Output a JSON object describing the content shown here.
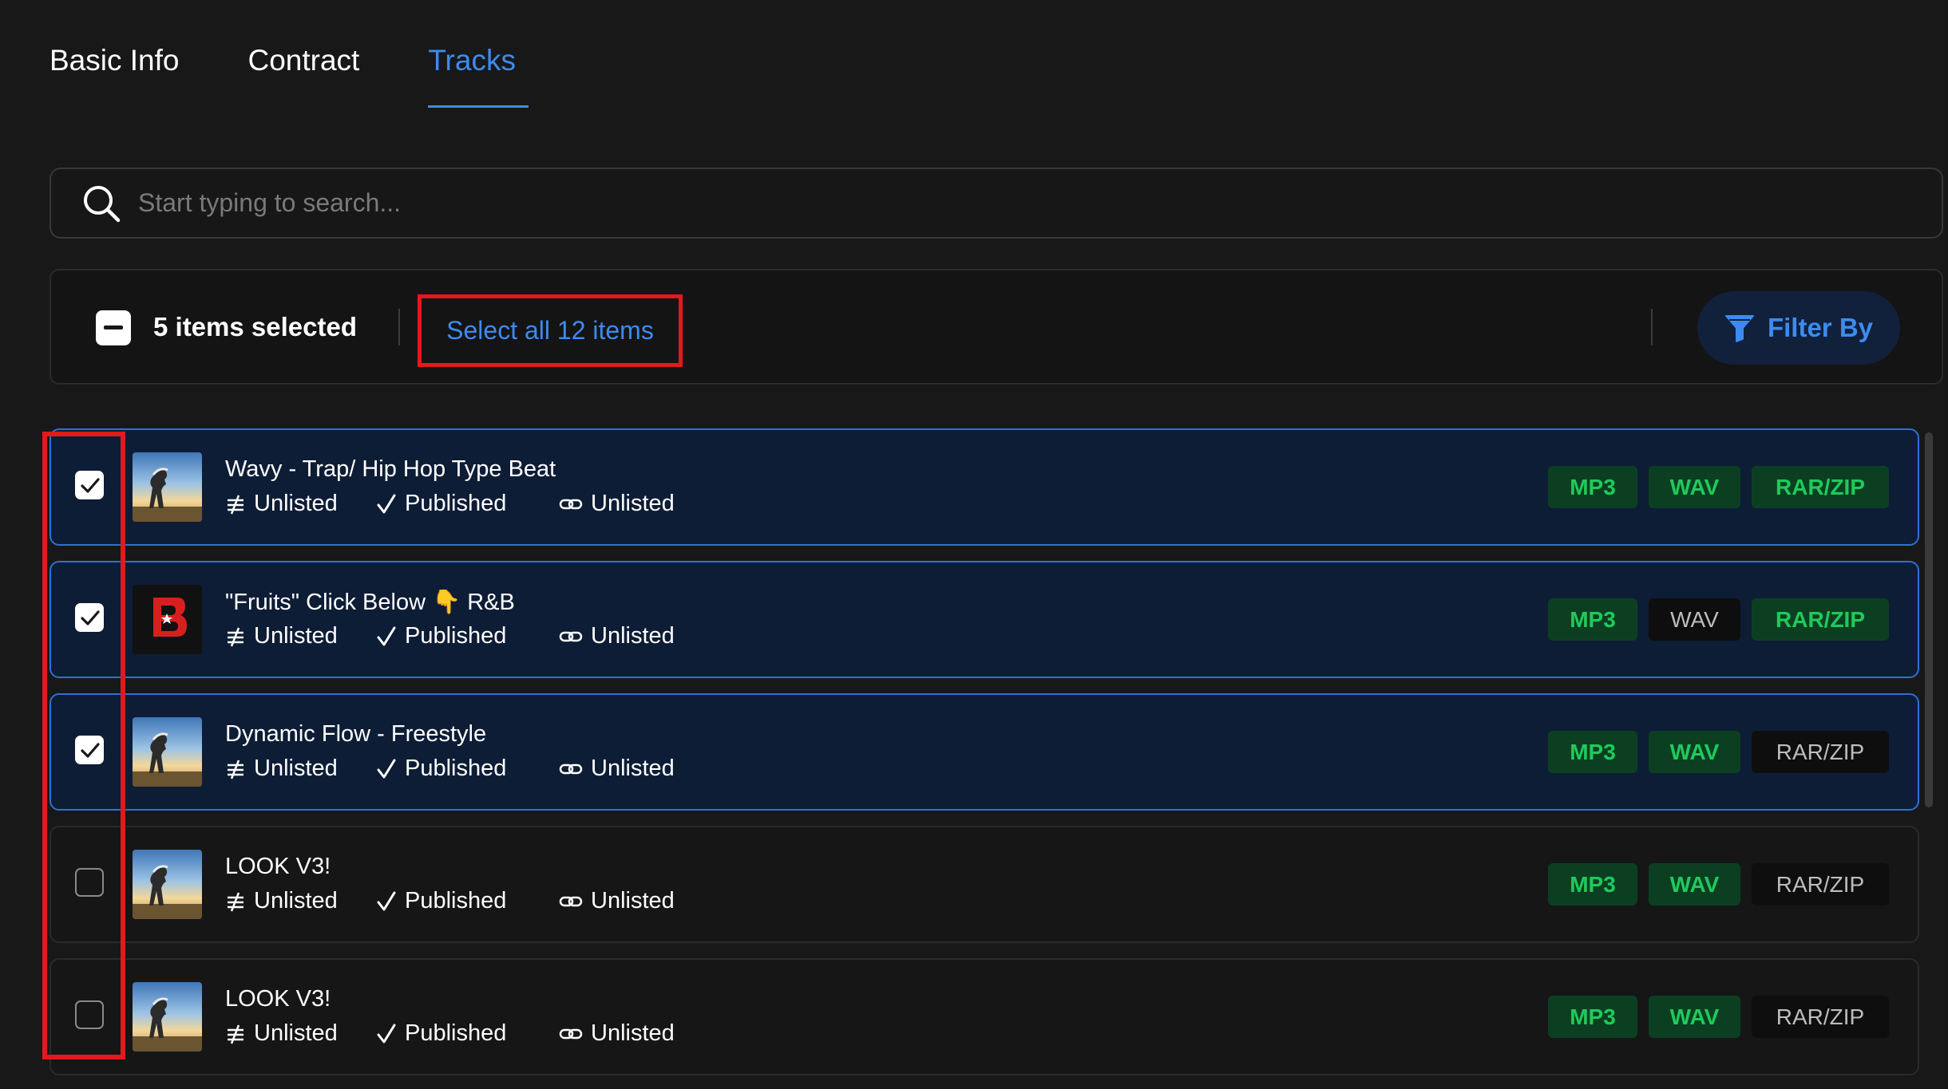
{
  "tabs": [
    {
      "label": "Basic Info",
      "active": false
    },
    {
      "label": "Contract",
      "active": false
    },
    {
      "label": "Tracks",
      "active": true
    }
  ],
  "search": {
    "placeholder": "Start typing to search..."
  },
  "toolbar": {
    "selected_count_label": "5 items selected",
    "select_all_label": "Select all 12 items",
    "filter_label": "Filter By"
  },
  "colors": {
    "accent": "#3d8bf0",
    "selected_row_bg": "#0e1d36",
    "highlight_box": "#e3191c",
    "badge_on_text": "#1fca5b",
    "badge_on_bg": "#0c3f22"
  },
  "tracks": [
    {
      "title": "Wavy - Trap/ Hip Hop Type Beat",
      "checked": true,
      "thumbnail": "sky-silhouette-image",
      "status_a": "Unlisted",
      "status_b": "Published",
      "status_c": "Unlisted",
      "formats": [
        {
          "label": "MP3",
          "available": true
        },
        {
          "label": "WAV",
          "available": true
        },
        {
          "label": "RAR/ZIP",
          "available": true
        }
      ]
    },
    {
      "title": "\"Fruits\" Click Below 👇 R&B",
      "checked": true,
      "thumbnail": "red-b-logo-image",
      "status_a": "Unlisted",
      "status_b": "Published",
      "status_c": "Unlisted",
      "formats": [
        {
          "label": "MP3",
          "available": true
        },
        {
          "label": "WAV",
          "available": false
        },
        {
          "label": "RAR/ZIP",
          "available": true
        }
      ]
    },
    {
      "title": "Dynamic Flow - Freestyle",
      "checked": true,
      "thumbnail": "sky-silhouette-image",
      "status_a": "Unlisted",
      "status_b": "Published",
      "status_c": "Unlisted",
      "formats": [
        {
          "label": "MP3",
          "available": true
        },
        {
          "label": "WAV",
          "available": true
        },
        {
          "label": "RAR/ZIP",
          "available": false
        }
      ]
    },
    {
      "title": "LOOK V3!",
      "checked": false,
      "thumbnail": "sky-silhouette-image",
      "status_a": "Unlisted",
      "status_b": "Published",
      "status_c": "Unlisted",
      "formats": [
        {
          "label": "MP3",
          "available": true
        },
        {
          "label": "WAV",
          "available": true
        },
        {
          "label": "RAR/ZIP",
          "available": false
        }
      ]
    },
    {
      "title": "LOOK V3!",
      "checked": false,
      "thumbnail": "sky-silhouette-image",
      "status_a": "Unlisted",
      "status_b": "Published",
      "status_c": "Unlisted",
      "formats": [
        {
          "label": "MP3",
          "available": true
        },
        {
          "label": "WAV",
          "available": true
        },
        {
          "label": "RAR/ZIP",
          "available": false
        }
      ]
    }
  ]
}
